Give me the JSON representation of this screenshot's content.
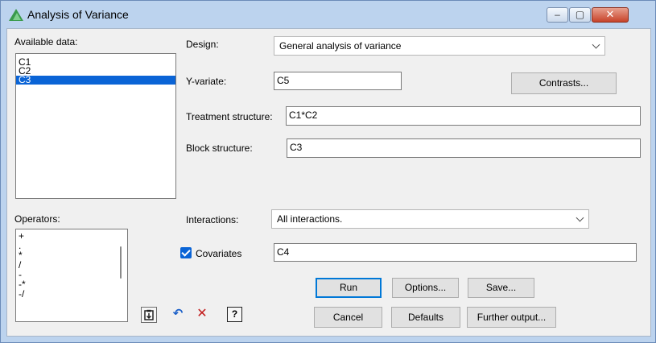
{
  "window": {
    "title": "Analysis of Variance",
    "minimize_glyph": "‒",
    "maximize_glyph": "▢",
    "close_glyph": "✕"
  },
  "available_data": {
    "label": "Available data:",
    "items": [
      "C1",
      "C2",
      "C3"
    ],
    "selected": "C3"
  },
  "design": {
    "label": "Design:",
    "value": "General analysis of variance"
  },
  "y_variate": {
    "label": "Y-variate:",
    "value": "C5"
  },
  "contrasts_button": "Contrasts...",
  "treatment_structure": {
    "label": "Treatment structure:",
    "value": "C1*C2"
  },
  "block_structure": {
    "label": "Block structure:",
    "value": "C3"
  },
  "operators": {
    "label": "Operators:",
    "items": [
      "+",
      ".",
      "*",
      "/",
      "-",
      "-*",
      "-/"
    ]
  },
  "interactions": {
    "label": "Interactions:",
    "value": "All interactions."
  },
  "covariates": {
    "label": "Covariates",
    "checked": true,
    "value": "C4"
  },
  "buttons": {
    "run": "Run",
    "options": "Options...",
    "save": "Save...",
    "cancel": "Cancel",
    "defaults": "Defaults",
    "further_output": "Further output..."
  },
  "toolbar": {
    "icons": [
      "clipboard-icon",
      "undo-icon",
      "clear-icon",
      "help-icon"
    ],
    "undo_glyph": "↶",
    "clear_glyph": "✕",
    "help_glyph": "?"
  },
  "colors": {
    "selection": "#0a64d6",
    "default_button_border": "#0078d7",
    "title_bar": "#bcd3ee",
    "close_button": "#c7432a"
  }
}
